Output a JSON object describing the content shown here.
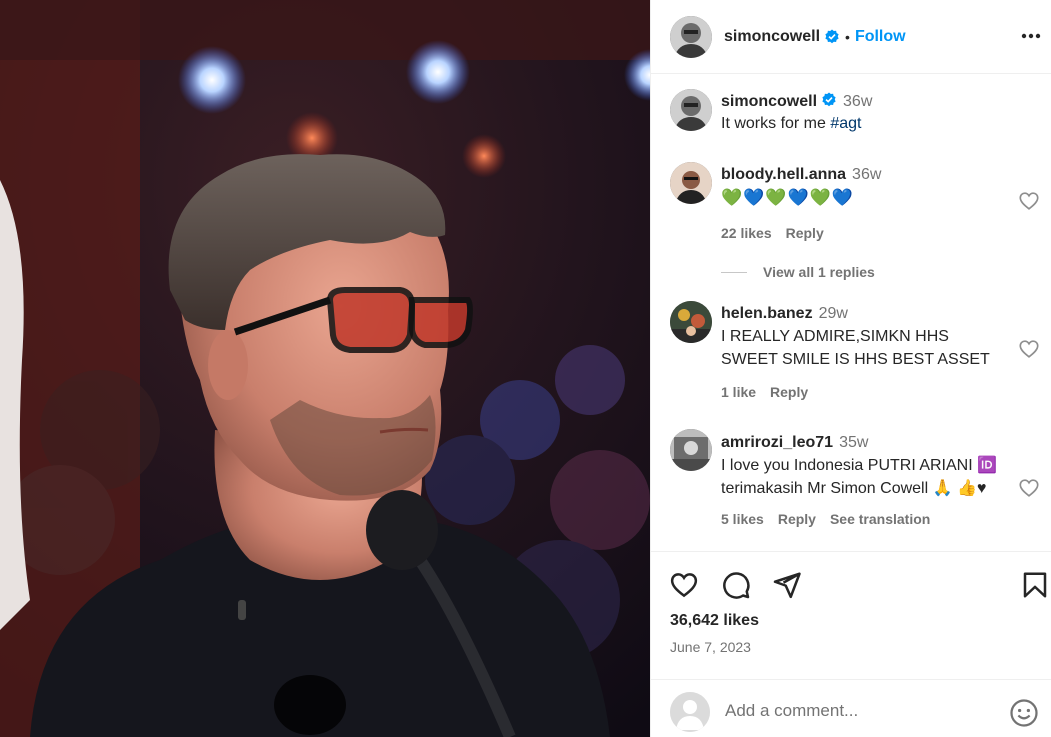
{
  "post": {
    "author": "simoncowell",
    "verified": true,
    "follow_label": "Follow",
    "dot": "•",
    "caption": {
      "username": "simoncowell",
      "time": "36w",
      "text": "It works for me ",
      "hashtag": "#agt"
    },
    "likes": "36,642 likes",
    "date": "June 7, 2023"
  },
  "comments": [
    {
      "username": "bloody.hell.anna",
      "time": "36w",
      "text": "💚💙💚💙💚💙",
      "likes": "22 likes",
      "reply_label": "Reply",
      "view_replies": "View all 1 replies"
    },
    {
      "username": "helen.banez",
      "time": "29w",
      "text": "I REALLY ADMIRE,SIMKN HHS SWEET SMILE IS HHS BEST ASSET",
      "likes": "1 like",
      "reply_label": "Reply"
    },
    {
      "username": "amrirozi_leo71",
      "time": "35w",
      "text": "I love you Indonesia PUTRI ARIANI 🆔 terimakasih Mr Simon Cowell 🙏 👍♥",
      "likes": "5 likes",
      "reply_label": "Reply",
      "translation_label": "See translation"
    }
  ],
  "add_comment": {
    "placeholder": "Add a comment..."
  },
  "icons": {
    "like": "heart-icon",
    "comment": "comment-icon",
    "share": "paper-plane-icon",
    "save": "bookmark-icon",
    "more": "more-options-icon",
    "emoji": "emoji-icon",
    "verified": "verified-badge-icon"
  },
  "colors": {
    "accent": "#0095f6",
    "verified": "#0095f6",
    "secondary_text": "#737373",
    "hashtag": "#00376b"
  }
}
